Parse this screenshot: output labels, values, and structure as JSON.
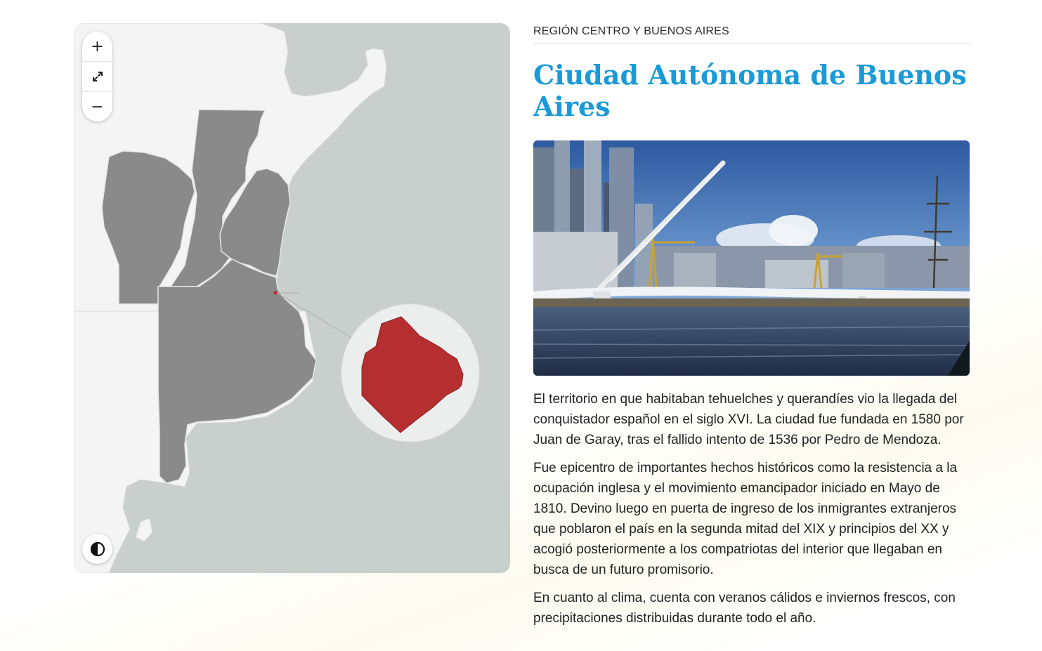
{
  "map": {
    "controls": {
      "zoom_in": "+",
      "fullscreen_icon": "expand-icon",
      "zoom_out": "−",
      "contrast_icon": "contrast-icon"
    },
    "colors": {
      "ocean": "#c8cfcd",
      "land": "#f3f4f3",
      "province": "#8a8a8a",
      "highlight": "#b52f31"
    },
    "highlighted_region": "Ciudad Autónoma de Buenos Aires"
  },
  "article": {
    "region": "REGIÓN CENTRO Y BUENOS AIRES",
    "title": "Ciudad Autónoma de Buenos Aires",
    "paragraphs": [
      "El territorio en que habitaban tehuelches y querandíes vio la llegada del conquistador español en el siglo XVI. La ciudad fue fundada en 1580 por Juan de Garay, tras el fallido intento de 1536 por Pedro de Mendoza.",
      "Fue epicentro de importantes hechos históricos como la resistencia a la ocupación inglesa y el movimiento emancipador iniciado en Mayo de 1810. Devino luego en puerta de ingreso de los inmigrantes extranjeros que poblaron el país en la segunda mitad del XIX y principios del XX y acogió posteriormente a los compatriotas del interior que llegaban en busca de un futuro promisorio.",
      "En cuanto al clima, cuenta con veranos cálidos e inviernos frescos, con precipitaciones distribuidas durante todo el año."
    ],
    "accent_color": "#1a9ad8"
  }
}
